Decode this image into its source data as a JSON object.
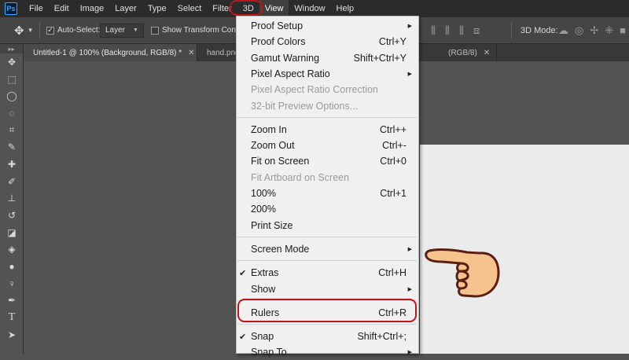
{
  "app": {
    "logo_text": "Ps"
  },
  "menubar": {
    "items": [
      "File",
      "Edit",
      "Image",
      "Layer",
      "Type",
      "Select",
      "Filter",
      "3D",
      "View",
      "Window",
      "Help"
    ],
    "active_item": "View"
  },
  "options_bar": {
    "move_tool_icon": "move-icon",
    "auto_select_checked": true,
    "auto_select_label": "Auto-Select:",
    "auto_select_target": "Layer",
    "transform_checked": false,
    "transform_label": "Show Transform Controls",
    "mode_3d_label": "3D Mode:"
  },
  "tabs": [
    {
      "title": "Untitled-1 @ 100% (Background, RGB/8) *",
      "active": true
    },
    {
      "title": "hand.png",
      "active": false
    },
    {
      "title": "(RGB/8)",
      "active": false
    }
  ],
  "tools": [
    "move-icon",
    "marquee-icon",
    "lasso-icon",
    "quick-select-icon",
    "crop-icon",
    "eyedropper-icon",
    "healing-brush-icon",
    "brush-icon",
    "clone-stamp-icon",
    "history-brush-icon",
    "eraser-icon",
    "paint-bucket-icon",
    "blur-icon",
    "dodge-icon",
    "pen-icon",
    "type-icon",
    "path-select-icon"
  ],
  "view_menu": {
    "items": [
      {
        "label": "Proof Setup",
        "shortcut": "",
        "submenu": true,
        "disabled": false,
        "checked": false
      },
      {
        "label": "Proof Colors",
        "shortcut": "Ctrl+Y",
        "submenu": false,
        "disabled": false,
        "checked": false
      },
      {
        "label": "Gamut Warning",
        "shortcut": "Shift+Ctrl+Y",
        "submenu": false,
        "disabled": false,
        "checked": false
      },
      {
        "label": "Pixel Aspect Ratio",
        "shortcut": "",
        "submenu": true,
        "disabled": false,
        "checked": false
      },
      {
        "label": "Pixel Aspect Ratio Correction",
        "shortcut": "",
        "submenu": false,
        "disabled": true,
        "checked": false
      },
      {
        "label": "32-bit Preview Options...",
        "shortcut": "",
        "submenu": false,
        "disabled": true,
        "checked": false
      },
      {
        "separator": true
      },
      {
        "label": "Zoom In",
        "shortcut": "Ctrl++",
        "submenu": false,
        "disabled": false,
        "checked": false
      },
      {
        "label": "Zoom Out",
        "shortcut": "Ctrl+-",
        "submenu": false,
        "disabled": false,
        "checked": false
      },
      {
        "label": "Fit on Screen",
        "shortcut": "Ctrl+0",
        "submenu": false,
        "disabled": false,
        "checked": false
      },
      {
        "label": "Fit Artboard on Screen",
        "shortcut": "",
        "submenu": false,
        "disabled": true,
        "checked": false
      },
      {
        "label": "100%",
        "shortcut": "Ctrl+1",
        "submenu": false,
        "disabled": false,
        "checked": false
      },
      {
        "label": "200%",
        "shortcut": "",
        "submenu": false,
        "disabled": false,
        "checked": false
      },
      {
        "label": "Print Size",
        "shortcut": "",
        "submenu": false,
        "disabled": false,
        "checked": false
      },
      {
        "separator": true
      },
      {
        "label": "Screen Mode",
        "shortcut": "",
        "submenu": true,
        "disabled": false,
        "checked": false
      },
      {
        "separator": true
      },
      {
        "label": "Extras",
        "shortcut": "Ctrl+H",
        "submenu": false,
        "disabled": false,
        "checked": true
      },
      {
        "label": "Show",
        "shortcut": "",
        "submenu": true,
        "disabled": false,
        "checked": false
      },
      {
        "separator": true
      },
      {
        "label": "Rulers",
        "shortcut": "Ctrl+R",
        "submenu": false,
        "disabled": false,
        "checked": false,
        "highlighted": true
      },
      {
        "separator": true
      },
      {
        "label": "Snap",
        "shortcut": "Shift+Ctrl+;",
        "submenu": false,
        "disabled": false,
        "checked": true
      },
      {
        "label": "Snap To",
        "shortcut": "",
        "submenu": true,
        "disabled": false,
        "checked": false
      }
    ]
  },
  "annotation": {
    "highlight_color": "#c0141a",
    "hand_color": "#f6c38e"
  },
  "colors": {
    "menubar": "#2b2b2b",
    "options_bar": "#454545",
    "workspace": "#535353",
    "menu_bg": "#f0f0f0",
    "canvas": "#ebebeb"
  }
}
